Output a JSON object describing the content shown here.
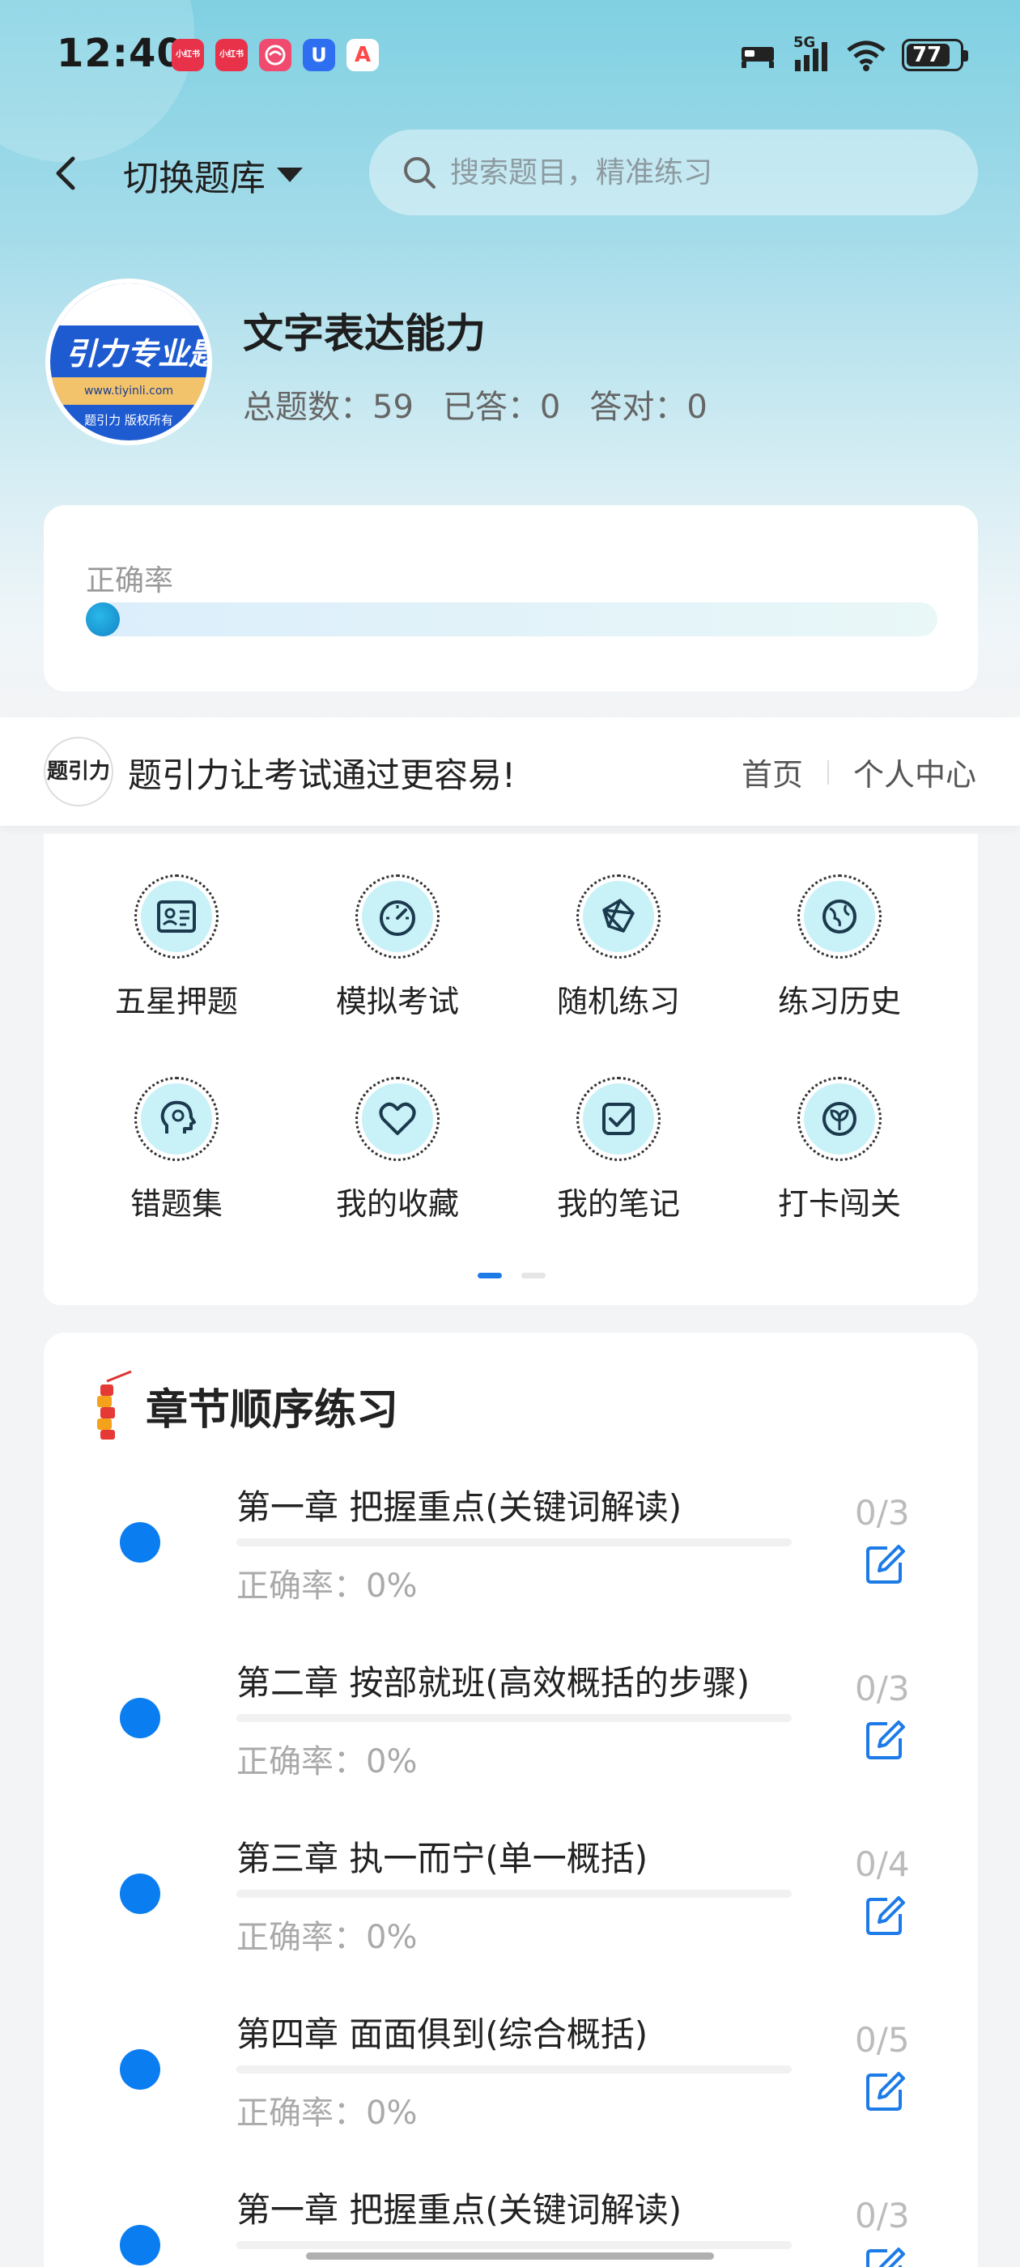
{
  "status_bar": {
    "time": "12:40",
    "apps": [
      {
        "name": "xiaohongshu-icon",
        "label": "小红书",
        "color": "#e8324a"
      },
      {
        "name": "xiaohongshu-icon",
        "label": "小红书",
        "color": "#e8324a"
      },
      {
        "name": "pink-app-icon",
        "label": "",
        "color": "#f04a6e"
      },
      {
        "name": "blue-u-icon",
        "label": "U",
        "color": "#2e6ff2"
      },
      {
        "name": "red-a-icon",
        "label": "A",
        "color": "#ff4a4a"
      }
    ],
    "network": "5G",
    "battery": "77"
  },
  "nav": {
    "switch_label": "切换题库",
    "search_placeholder": "搜索题目，精准练习"
  },
  "course": {
    "logo_text": "引力专业题",
    "logo_url": "www.tiyinli.com",
    "logo_copyright": "题引力 版权所有",
    "title": "文字表达能力",
    "total": "总题数：59",
    "answered": "已答：0",
    "correct": "答对：0"
  },
  "accuracy": {
    "label": "正确率",
    "value": 0
  },
  "banner": {
    "logo_text": "题引力",
    "slogan": "题引力让考试通过更容易!",
    "home": "首页",
    "profile": "个人中心"
  },
  "features": [
    {
      "label": "五星押题",
      "icon": "id-card-icon"
    },
    {
      "label": "模拟考试",
      "icon": "gauge-icon"
    },
    {
      "label": "随机练习",
      "icon": "network-icon"
    },
    {
      "label": "练习历史",
      "icon": "globe-icon"
    },
    {
      "label": "错题集",
      "icon": "head-icon"
    },
    {
      "label": "我的收藏",
      "icon": "heart-icon"
    },
    {
      "label": "我的笔记",
      "icon": "check-note-icon"
    },
    {
      "label": "打卡闯关",
      "icon": "leaf-icon"
    }
  ],
  "chapters": {
    "heading": "章节顺序练习",
    "items": [
      {
        "title": "第一章 把握重点(关键词解读)",
        "accuracy": "正确率：0%",
        "count": "0/3"
      },
      {
        "title": "第二章 按部就班(高效概括的步骤)",
        "accuracy": "正确率：0%",
        "count": "0/3"
      },
      {
        "title": "第三章 执一而宁(单一概括)",
        "accuracy": "正确率：0%",
        "count": "0/4"
      },
      {
        "title": "第四章 面面俱到(综合概括)",
        "accuracy": "正确率：0%",
        "count": "0/5"
      },
      {
        "title": "第一章 把握重点(关键词解读)",
        "accuracy": "",
        "count": "0/3"
      }
    ]
  }
}
